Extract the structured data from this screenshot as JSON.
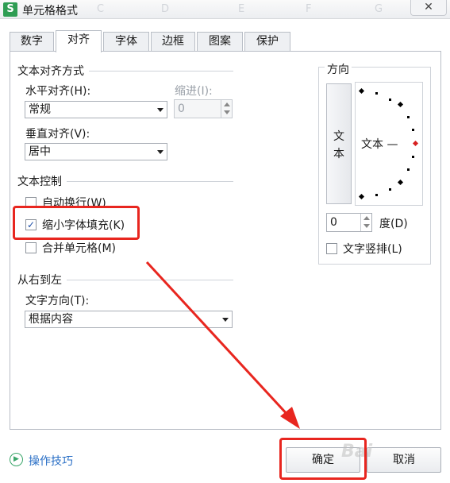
{
  "window": {
    "app_icon": "S",
    "title": "单元格格式",
    "bg_columns": [
      "C",
      "D",
      "E",
      "F",
      "G"
    ],
    "close_label": "✕"
  },
  "tabs": [
    "数字",
    "对齐",
    "字体",
    "边框",
    "图案",
    "保护"
  ],
  "active_tab": "对齐",
  "alignment": {
    "section_label": "文本对齐方式",
    "horizontal_label": "水平对齐(H):",
    "horizontal_value": "常规",
    "indent_label": "缩进(I):",
    "indent_value": "0",
    "vertical_label": "垂直对齐(V):",
    "vertical_value": "居中"
  },
  "text_control": {
    "section_label": "文本控制",
    "wrap_label": "自动换行(W)",
    "wrap_checked": false,
    "shrink_label": "缩小字体填充(K)",
    "shrink_checked": true,
    "merge_label": "合并单元格(M)",
    "merge_checked": false
  },
  "rtl": {
    "section_label": "从右到左",
    "direction_label": "文字方向(T):",
    "direction_value": "根据内容"
  },
  "orientation": {
    "section_label": "方向",
    "vertical_text": "文本",
    "dial_text": "文本 —",
    "degree_value": "0",
    "degree_label": "度(D)",
    "vertical_stack_label": "文字竖排(L)",
    "vertical_stack_checked": false
  },
  "footer": {
    "help_icon": "play-circle-icon",
    "help_label": "操作技巧",
    "ok_label": "确定",
    "cancel_label": "取消",
    "watermark": "Bai"
  },
  "annotation_color": "#e8261f"
}
